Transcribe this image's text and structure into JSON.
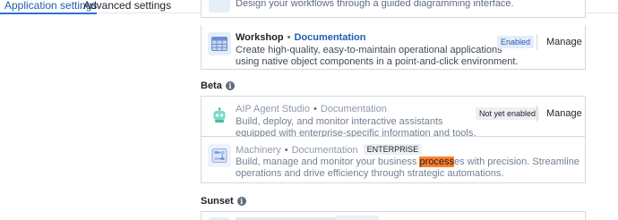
{
  "tabs": [
    {
      "label": "Application settings",
      "active": true
    },
    {
      "label": "Advanced settings",
      "active": false
    }
  ],
  "partial_row": {
    "description": "Design your workflows through a guided diagramming interface."
  },
  "apps": [
    {
      "name": "Workshop",
      "separator": "•",
      "doc_link": "Documentation",
      "description": "Create high-quality, easy-to-maintain operational applications using native object components in a point-and-click environment.",
      "status": "Enabled",
      "action": "Manage",
      "icon": "workshop-grid-icon"
    }
  ],
  "sections": {
    "beta": {
      "title": "Beta",
      "info_icon": "info-icon"
    },
    "sunset": {
      "title": "Sunset",
      "info_icon": "info-icon"
    }
  },
  "beta_apps": [
    {
      "name": "AIP Agent Studio",
      "separator": "•",
      "doc_link": "Documentation",
      "description": "Build, deploy, and monitor interactive assistants equipped with enterprise-specific information and tools.",
      "status": "Not yet enabled",
      "action": "Manage",
      "icon": "robot-icon"
    },
    {
      "name": "Machinery",
      "separator": "•",
      "doc_link": "Documentation",
      "tag": "ENTERPRISE",
      "description_before": "Build, manage and monitor your business ",
      "description_highlight": "process",
      "description_after": "es with precision. Streamline operations and drive efficiency through strategic automations.",
      "icon": "machinery-flow-icon"
    }
  ],
  "colors": {
    "accent": "#2d72d2",
    "link": "#215db0",
    "highlight": "#ff7f2a",
    "robot_icon": "#3fbfa6"
  }
}
